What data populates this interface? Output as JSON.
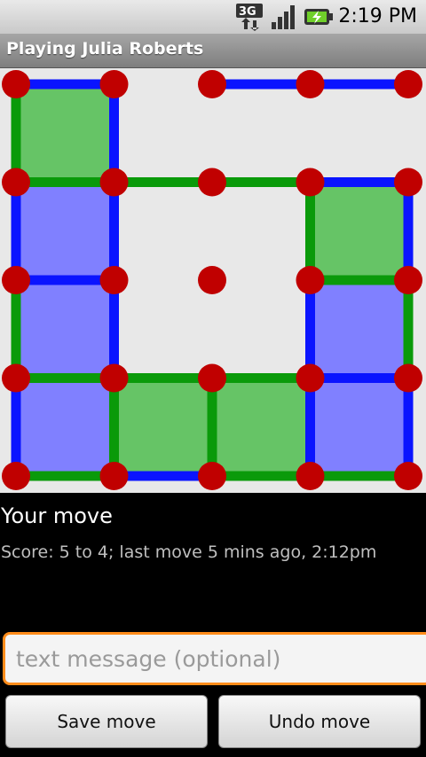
{
  "status_bar": {
    "time": "2:19 PM",
    "network": "3G",
    "icons": [
      "3g-data-icon",
      "signal-strength-icon",
      "battery-charging-icon"
    ]
  },
  "title": "Playing Julia Roberts",
  "board": {
    "rows": 5,
    "cols": 5,
    "colors": {
      "green": "#0a9a0a",
      "blue": "#0a14ff",
      "green_fill": "#66c466",
      "blue_fill": "#8080ff",
      "dot": "#c00000",
      "background": "#e8e8e8"
    },
    "horizontal_lines": [
      [
        0,
        0,
        "blue"
      ],
      [
        0,
        2,
        "blue"
      ],
      [
        0,
        3,
        "blue"
      ],
      [
        1,
        0,
        "green"
      ],
      [
        1,
        1,
        "green"
      ],
      [
        1,
        2,
        "green"
      ],
      [
        1,
        3,
        "blue"
      ],
      [
        2,
        0,
        "blue"
      ],
      [
        2,
        3,
        "green"
      ],
      [
        3,
        0,
        "green"
      ],
      [
        3,
        1,
        "green"
      ],
      [
        3,
        2,
        "green"
      ],
      [
        3,
        3,
        "blue"
      ],
      [
        4,
        0,
        "green"
      ],
      [
        4,
        1,
        "blue"
      ],
      [
        4,
        2,
        "green"
      ],
      [
        4,
        3,
        "green"
      ]
    ],
    "vertical_lines": [
      [
        0,
        0,
        "green"
      ],
      [
        0,
        1,
        "blue"
      ],
      [
        1,
        0,
        "blue"
      ],
      [
        1,
        1,
        "blue"
      ],
      [
        1,
        3,
        "green"
      ],
      [
        1,
        4,
        "blue"
      ],
      [
        2,
        0,
        "green"
      ],
      [
        2,
        1,
        "blue"
      ],
      [
        2,
        3,
        "blue"
      ],
      [
        2,
        4,
        "green"
      ],
      [
        3,
        0,
        "blue"
      ],
      [
        3,
        1,
        "green"
      ],
      [
        3,
        2,
        "green"
      ],
      [
        3,
        3,
        "blue"
      ],
      [
        3,
        4,
        "blue"
      ]
    ],
    "boxes": [
      [
        0,
        0,
        "green"
      ],
      [
        1,
        0,
        "blue"
      ],
      [
        1,
        3,
        "green"
      ],
      [
        2,
        0,
        "blue"
      ],
      [
        2,
        3,
        "blue"
      ],
      [
        3,
        0,
        "blue"
      ],
      [
        3,
        1,
        "green"
      ],
      [
        3,
        2,
        "green"
      ],
      [
        3,
        3,
        "blue"
      ]
    ]
  },
  "move_status": "Your move",
  "score_line": "Score: 5 to 4; last move 5 mins ago, 2:12pm",
  "message": {
    "placeholder": "text message (optional)",
    "value": ""
  },
  "buttons": {
    "save": "Save move",
    "undo": "Undo move"
  }
}
